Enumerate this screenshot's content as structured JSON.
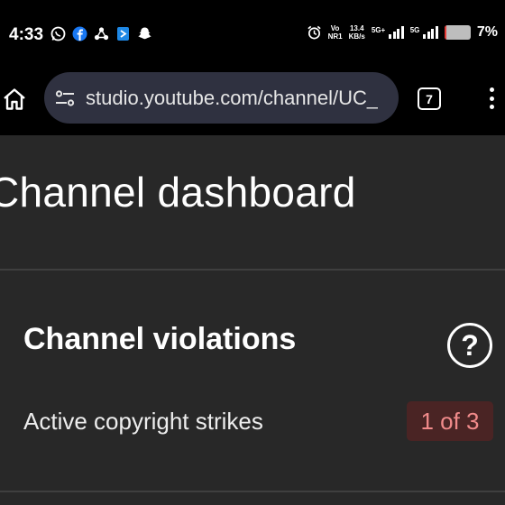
{
  "status_bar": {
    "time": "4:33",
    "icons_left": [
      "whatsapp-icon",
      "facebook-icon",
      "mesh-icon",
      "app-icon",
      "snapchat-icon"
    ],
    "alarm_icon": "alarm-icon",
    "vo_top": "Vo",
    "vo_bottom": "NR1",
    "speed_value": "13.4",
    "speed_unit": "KB/s",
    "sim1_label": "5G+",
    "sim2_label": "5G",
    "battery_percent": "7%",
    "battery_level": 0.07
  },
  "browser": {
    "url": "studio.youtube.com/channel/UC_",
    "tab_count": "7"
  },
  "page": {
    "title": "Channel dashboard",
    "card": {
      "title": "Channel violations",
      "strikes_label": "Active copyright strikes",
      "strikes_value": "1 of 3"
    }
  },
  "colors": {
    "page_bg": "#282828",
    "status_bg": "#000000",
    "url_bar_bg": "#2f3140",
    "strike_badge_bg": "#4a2424",
    "strike_badge_text": "#f08a8a"
  }
}
